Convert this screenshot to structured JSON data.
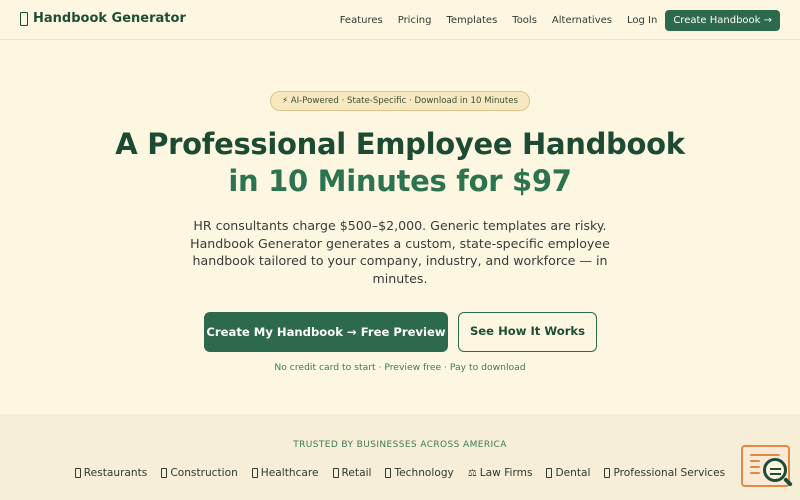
{
  "nav": {
    "brand": "Handbook Generator",
    "links": [
      "Features",
      "Pricing",
      "Templates",
      "Tools",
      "Alternatives",
      "Log In"
    ],
    "cta": "Create Handbook →"
  },
  "hero": {
    "badge": "⚡ AI-Powered · State-Specific · Download in 10 Minutes",
    "title_line1": "A Professional Employee Handbook",
    "title_line2": "in 10 Minutes for $97",
    "subtitle": "HR consultants charge $500–$2,000. Generic templates are risky. Handbook Generator generates a custom, state-specific employee handbook tailored to your company, industry, and workforce — in minutes.",
    "primary_button": "Create My Handbook → Free Preview",
    "secondary_button": "See How It Works",
    "note": "No credit card to start · Preview free · Pay to download"
  },
  "trusted": {
    "title": "TRUSTED BY BUSINESSES ACROSS AMERICA",
    "industries": [
      {
        "label": "Restaurants",
        "icon": "restaurant-icon"
      },
      {
        "label": "Construction",
        "icon": "construction-icon"
      },
      {
        "label": "Healthcare",
        "icon": "healthcare-icon"
      },
      {
        "label": "Retail",
        "icon": "retail-icon"
      },
      {
        "label": "Technology",
        "icon": "technology-icon"
      },
      {
        "label": "Law Firms",
        "icon": "scale-icon"
      },
      {
        "label": "Dental",
        "icon": "dental-icon"
      },
      {
        "label": "Professional Services",
        "icon": "briefcase-icon"
      }
    ]
  },
  "colors": {
    "background": "#fdf7e2",
    "accent": "#2d6a4b",
    "heading": "#1d4a33"
  }
}
